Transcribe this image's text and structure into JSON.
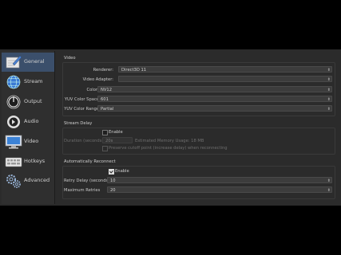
{
  "sidebar": {
    "items": [
      {
        "label": "General",
        "icon": "general-icon",
        "active": true
      },
      {
        "label": "Stream",
        "icon": "stream-globe-icon",
        "active": false
      },
      {
        "label": "Output",
        "icon": "output-icon",
        "active": false
      },
      {
        "label": "Audio",
        "icon": "audio-icon",
        "active": false
      },
      {
        "label": "Video",
        "icon": "video-monitor-icon",
        "active": false
      },
      {
        "label": "Hotkeys",
        "icon": "keyboard-icon",
        "active": false
      },
      {
        "label": "Advanced",
        "icon": "gears-icon",
        "active": false
      }
    ]
  },
  "video": {
    "title": "Video",
    "renderer_label": "Renderer:",
    "renderer_value": "Direct3D 11",
    "adapter_label": "Video Adapter:",
    "adapter_value": "",
    "color_format_label": "Color Format",
    "color_format_value": "NV12",
    "color_space_label": "YUV Color Space",
    "color_space_value": "601",
    "color_range_label": "YUV Color Range",
    "color_range_value": "Partial"
  },
  "stream_delay": {
    "title": "Stream Delay",
    "enable_label": "Enable",
    "duration_label": "Duration (seconds)",
    "duration_value": "20s",
    "memory_note": "Estimated Memory Usage: 18 MB",
    "preserve_label": "Preserve cutoff point (increase delay) when reconnecting"
  },
  "auto_reconnect": {
    "title": "Automatically Reconnect",
    "enable_label": "Enable",
    "retry_delay_label": "Retry Delay (seconds)",
    "retry_delay_value": "10",
    "max_retries_label": "Maximum Retries",
    "max_retries_value": "20"
  },
  "colors": {
    "active_item": "#3b4f6b",
    "panel_bg": "#2b2b2b"
  }
}
